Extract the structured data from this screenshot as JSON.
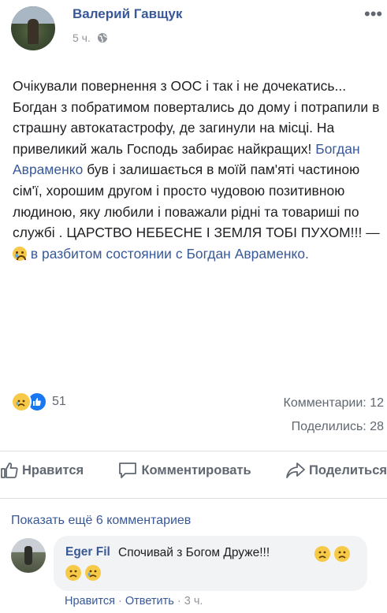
{
  "post": {
    "author": "Валерий Гавщук",
    "time": "5 ч.",
    "more_label": "•••",
    "text_part1": "Очікували повернення з ООС і так і не дочекатись... Богдан з побратимом повертались до дому і потрапили в страшну автокатастрофу, де загинули на місці. На привеликий жаль Господь забирає найкращих! ",
    "tagged_name_1": "Богдан Авраменко",
    "text_part2": " був і залишається в моїй пам'яті частиною сім'ї, хорошим другом і просто чудовою позитивною людиною, яку любили і поважали рідні та товариші по службі . ЦАРСТВО НЕБЕСНЕ І ЗЕМЛЯ ТОБІ ПУХОМ!!! — ",
    "feeling_text": "в разбитом состоянии с ",
    "tagged_name_2": "Богдан Авраменко",
    "text_end": "."
  },
  "reactions": {
    "count": "51",
    "comments": "Комментарии: 12",
    "shares": "Поделились: 28"
  },
  "actions": {
    "like": "Нравится",
    "comment": "Комментировать",
    "share": "Поделиться"
  },
  "comments": {
    "show_more": "Показать ещё 6 комментариев",
    "items": [
      {
        "author": "Eger Fil",
        "text": "Спочивай з Богом Друже!!!",
        "like": "Нравится",
        "reply": "Ответить",
        "time": "3 ч."
      }
    ]
  },
  "colors": {
    "link": "#385898",
    "secondary": "#606770",
    "meta": "#90949c"
  }
}
